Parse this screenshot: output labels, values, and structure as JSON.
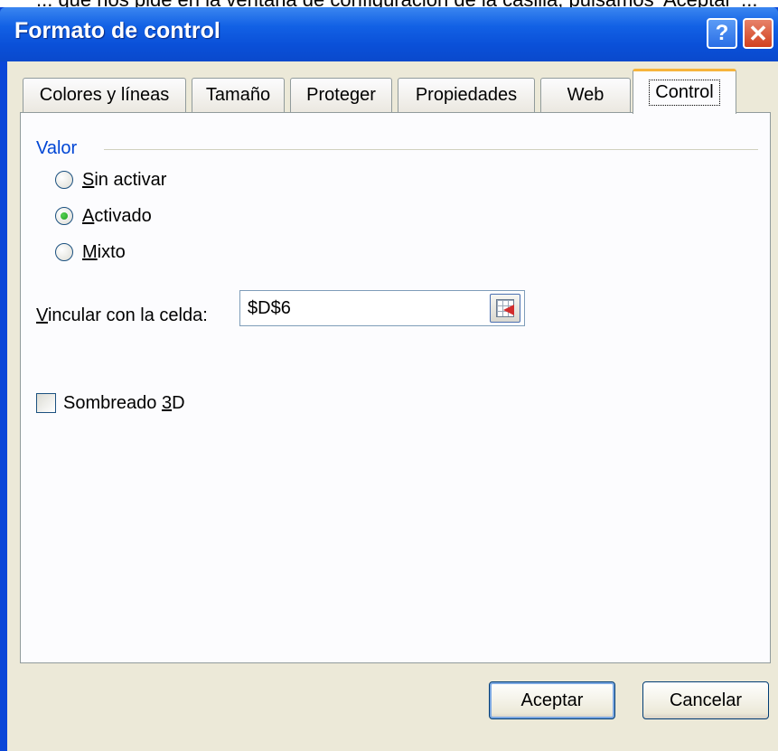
{
  "caption": {
    "fragment": "... que nos pide en la ventana de configuración de la casilla, pulsamos 'Aceptar' ..."
  },
  "dialog": {
    "title": "Formato de control",
    "help_glyph": "?",
    "close_glyph": "✕"
  },
  "tabs": [
    {
      "label": "Colores y líneas",
      "active": false
    },
    {
      "label": "Tamaño",
      "active": false
    },
    {
      "label": "Proteger",
      "active": false
    },
    {
      "label": "Propiedades",
      "active": false
    },
    {
      "label": "Web",
      "active": false
    },
    {
      "label": "Control",
      "active": true
    }
  ],
  "control_tab": {
    "group_label": "Valor",
    "options": [
      {
        "label_accel": "S",
        "label_rest": "in activar",
        "checked": false
      },
      {
        "label_accel": "A",
        "label_rest": "ctivado",
        "checked": true
      },
      {
        "label_accel": "M",
        "label_rest": "ixto",
        "checked": false
      }
    ],
    "link_cell": {
      "label_accel": "V",
      "label_rest": "incular con la celda:",
      "value": "$D$6"
    },
    "shading": {
      "label_pre": "Sombreado ",
      "label_accel": "3",
      "label_post": "D",
      "checked": false
    }
  },
  "buttons": {
    "ok": "Aceptar",
    "cancel": "Cancelar"
  },
  "colors": {
    "titlebar": "#0a50d8",
    "dialog_bg": "#ece9d8",
    "group_label": "#0046d5"
  },
  "icons": [
    "help-icon",
    "close-icon",
    "cell-reference-icon"
  ]
}
